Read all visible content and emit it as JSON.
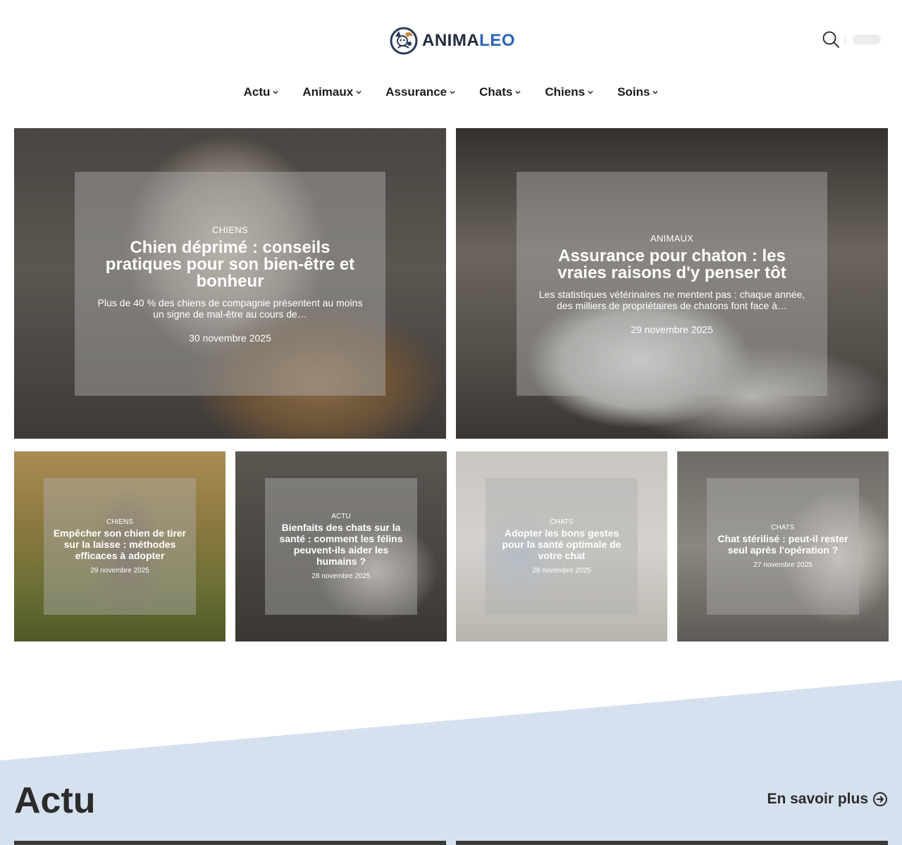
{
  "brand": {
    "name_part1": "ANIMA",
    "name_part2": "LEO",
    "accent": "#2a63b8",
    "dark": "#1f2a3a"
  },
  "header": {
    "search_icon": "search-icon"
  },
  "nav": {
    "items": [
      {
        "label": "Actu"
      },
      {
        "label": "Animaux"
      },
      {
        "label": "Assurance"
      },
      {
        "label": "Chats"
      },
      {
        "label": "Chiens"
      },
      {
        "label": "Soins"
      }
    ]
  },
  "featured": [
    {
      "category": "CHIENS",
      "title": "Chien déprimé : conseils pratiques pour son bien-être et bonheur",
      "excerpt": "Plus de 40 % des chiens de compagnie présentent au moins un signe de mal-être au cours de…",
      "date": "30 novembre 2025"
    },
    {
      "category": "ANIMAUX",
      "title": "Assurance pour chaton : les vraies raisons d'y penser tôt",
      "excerpt": "Les statistiques vétérinaires ne mentent pas : chaque année, des milliers de propriétaires de chatons font face à…",
      "date": "29 novembre 2025"
    }
  ],
  "grid": [
    {
      "category": "CHIENS",
      "title": "Empêcher son chien de tirer sur la laisse : méthodes efficaces à adopter",
      "date": "29 novembre 2025"
    },
    {
      "category": "ACTU",
      "title": "Bienfaits des chats sur la santé : comment les félins peuvent-ils aider les humains ?",
      "date": "28 novembre 2025"
    },
    {
      "category": "CHATS",
      "title": "Adopter les bons gestes pour la santé optimale de votre chat",
      "date": "28 novembre 2025"
    },
    {
      "category": "CHATS",
      "title": "Chat stérilisé : peut-il rester seul après l'opération ?",
      "date": "27 novembre 2025"
    }
  ],
  "section": {
    "title": "Actu",
    "more_label": "En savoir plus",
    "bg_color": "#d5e1ef"
  }
}
